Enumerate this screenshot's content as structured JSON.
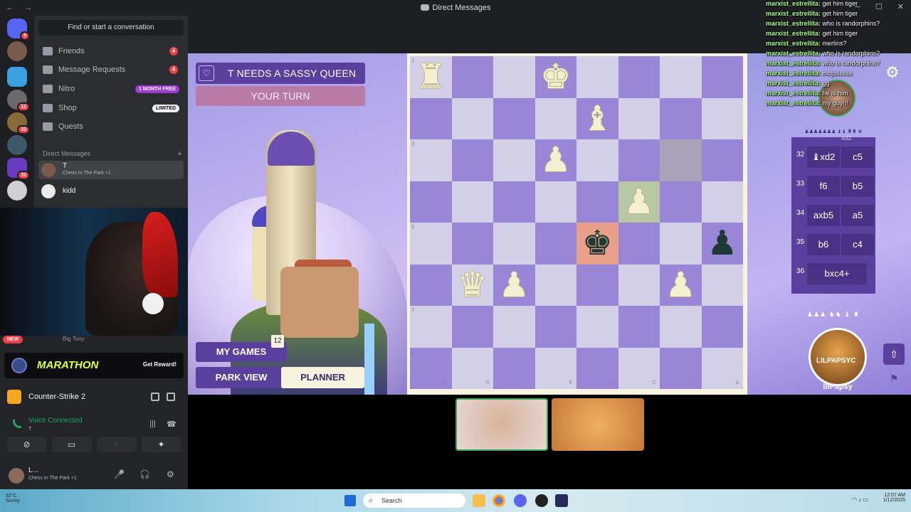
{
  "titlebar": {
    "title": "Direct Messages",
    "back": "←",
    "forward": "→",
    "minimize": "─",
    "maximize": "☐",
    "close": "✕"
  },
  "rail": {
    "badges": [
      "9",
      "12",
      "32",
      "32"
    ]
  },
  "sidebar": {
    "find_label": "Find or start a conversation",
    "items": [
      {
        "label": "Friends",
        "count": "4"
      },
      {
        "label": "Message Requests",
        "count": "4"
      },
      {
        "label": "Nitro",
        "tag": "1 MONTH FREE"
      },
      {
        "label": "Shop",
        "tag": "LIMITED"
      },
      {
        "label": "Quests"
      }
    ],
    "dm_header": "Direct Messages",
    "dm_plus": "+",
    "dms": [
      {
        "name": "T",
        "sub": "Chess In The Park +1"
      },
      {
        "name": "kidd",
        "sub": ""
      }
    ],
    "partial_name": "Big Tony"
  },
  "lower": {
    "new_badge": "NEW",
    "promo_word": "MARATHON",
    "promo_reward": "Get Reward!",
    "game_name": "Counter-Strike 2",
    "voice_status": "Voice Connected",
    "voice_channel": "T",
    "user_name": "L...",
    "user_status": "Chess In The Park +1"
  },
  "game": {
    "title": "T NEEDS A SASSY QUEEN",
    "heart": "♡",
    "turn": "YOUR TURN",
    "my_games": "MY GAMES",
    "my_games_count": "12",
    "park_view": "PARK VIEW",
    "planner": "PLANNER",
    "ranks": [
      "1",
      "2",
      "3",
      "4",
      "5",
      "6",
      "7",
      "8"
    ],
    "files": [
      "H",
      "G",
      "F",
      "E",
      "D",
      "C",
      "B",
      "A"
    ],
    "pieces": [
      {
        "glyph": "♜",
        "color": "w",
        "rank": 0,
        "file": 0
      },
      {
        "glyph": "♚",
        "color": "w",
        "rank": 0,
        "file": 3
      },
      {
        "glyph": "♝",
        "color": "w",
        "rank": 1,
        "file": 4
      },
      {
        "glyph": "♟",
        "color": "w",
        "rank": 2,
        "file": 3
      },
      {
        "glyph": "♟",
        "color": "w",
        "rank": 3,
        "file": 5
      },
      {
        "glyph": "♚",
        "color": "b",
        "rank": 4,
        "file": 4
      },
      {
        "glyph": "♟",
        "color": "b",
        "rank": 4,
        "file": 7
      },
      {
        "glyph": "♛",
        "color": "w",
        "rank": 5,
        "file": 1
      },
      {
        "glyph": "♟",
        "color": "w",
        "rank": 5,
        "file": 2
      },
      {
        "glyph": "♟",
        "color": "w",
        "rank": 5,
        "file": 6
      }
    ],
    "moves": [
      {
        "num": "32",
        "white": "♝xd2",
        "black": "c5"
      },
      {
        "num": "33",
        "white": "f6",
        "black": "b5"
      },
      {
        "num": "34",
        "white": "axb5",
        "black": "a5"
      },
      {
        "num": "35",
        "white": "b6",
        "black": "c4"
      },
      {
        "num": "36",
        "white": "bxc4+",
        "black": ""
      }
    ],
    "moves_partial": "xd2",
    "captured_top": "♟♟♟♟♟♟♟ ♝♝ ♜♜ ♛",
    "captured_bottom": "♟♟♟ ♞♞ ♝ ♜",
    "player_name": "lllPapsy",
    "avatar_text": "LILPAPSYC",
    "gear": "⚙",
    "share": "⇧",
    "flag": "⚑"
  },
  "chat": [
    {
      "user": "marxist_estrellita:",
      "msg": "get him tiger"
    },
    {
      "user": "marxist_estrellita:",
      "msg": "get him tiger"
    },
    {
      "user": "marxist_estrellita:",
      "msg": "who is randorphins?"
    },
    {
      "user": "marxist_estrellita:",
      "msg": "get him tiger"
    },
    {
      "user": "marxist_estrellita:",
      "msg": "merlins?"
    },
    {
      "user": "marxist_estrellita:",
      "msg": "who is randorphins?"
    },
    {
      "user": "marxist_estrellita:",
      "msg": "who is randorphins?"
    },
    {
      "user": "marxist_estrellita:",
      "msg": "mojusssss"
    },
    {
      "user": "marxist_estrellita:",
      "msg": "gg"
    },
    {
      "user": "marxist_estrellita:",
      "msg": "he is him"
    },
    {
      "user": "marxist_estrellita:",
      "msg": "my guy!!!"
    }
  ],
  "taskbar": {
    "weather": "32°C",
    "weather_sub": "Sunny",
    "search": "Search",
    "time": "12:07 AM",
    "date": "1/12/2025"
  }
}
